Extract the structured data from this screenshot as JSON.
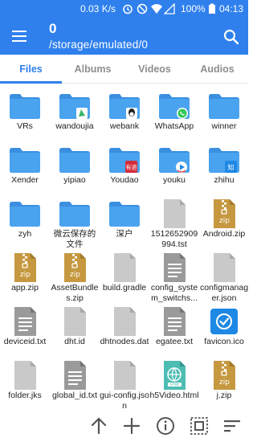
{
  "status_bar": {
    "speed": "0.03 K/s",
    "battery": "100%",
    "time": "04:13",
    "icons": [
      "alarm-icon",
      "no-sound-icon",
      "wifi-icon",
      "cellular-off-icon",
      "battery-icon"
    ]
  },
  "app_bar": {
    "item_count": "0",
    "path": "/storage/emulated/0",
    "icons": {
      "menu": "menu-icon",
      "search": "search-icon"
    }
  },
  "tabs": [
    {
      "label": "Files",
      "active": true
    },
    {
      "label": "Albums",
      "active": false
    },
    {
      "label": "Videos",
      "active": false
    },
    {
      "label": "Audios",
      "active": false
    }
  ],
  "files": [
    {
      "name": "VRs",
      "type": "folder"
    },
    {
      "name": "wandoujia",
      "type": "folder",
      "badge": "wandoujia"
    },
    {
      "name": "webank",
      "type": "folder",
      "badge": "qq"
    },
    {
      "name": "WhatsApp",
      "type": "folder",
      "badge": "whatsapp"
    },
    {
      "name": "winner",
      "type": "folder"
    },
    {
      "name": "Xender",
      "type": "folder"
    },
    {
      "name": "yipiao",
      "type": "folder"
    },
    {
      "name": "Youdao",
      "type": "folder",
      "badge": "youdao",
      "badge_text": "有道"
    },
    {
      "name": "youku",
      "type": "folder",
      "badge": "youku"
    },
    {
      "name": "zhihu",
      "type": "folder",
      "badge": "zhihu",
      "badge_text": "知"
    },
    {
      "name": "zyh",
      "type": "folder"
    },
    {
      "name": "微云保存的文件",
      "type": "folder"
    },
    {
      "name": "深户",
      "type": "folder"
    },
    {
      "name": "1512652909994.tst",
      "type": "doc-blank"
    },
    {
      "name": "Android.zip",
      "type": "zip",
      "ext_label": "zip"
    },
    {
      "name": "app.zip",
      "type": "zip",
      "ext_label": "zip"
    },
    {
      "name": "AssetBundles.zip",
      "type": "zip",
      "ext_label": "zip"
    },
    {
      "name": "build.gradle",
      "type": "doc-blank"
    },
    {
      "name": "config_system_switchs...",
      "type": "doc-lines"
    },
    {
      "name": "configmanager.json",
      "type": "doc-blank"
    },
    {
      "name": "deviceid.txt",
      "type": "doc-lines"
    },
    {
      "name": "dht.id",
      "type": "doc-blank"
    },
    {
      "name": "dhtnodes.dat",
      "type": "doc-blank"
    },
    {
      "name": "egatee.txt",
      "type": "doc-lines"
    },
    {
      "name": "favicon.ico",
      "type": "image-check"
    },
    {
      "name": "folder.jks",
      "type": "doc-blank"
    },
    {
      "name": "global_id.txt",
      "type": "doc-lines"
    },
    {
      "name": "gui-config.json",
      "type": "doc-blank"
    },
    {
      "name": "h5Video.html",
      "type": "html"
    },
    {
      "name": "j.zip",
      "type": "zip",
      "ext_label": "zip"
    }
  ],
  "bottom_bar": {
    "icons": [
      "up-arrow-icon",
      "add-icon",
      "info-icon",
      "select-all-icon",
      "sort-icon"
    ]
  },
  "colors": {
    "primary": "#2f80ed",
    "folder": "#4aa3ef",
    "folder_back": "#3b8fe0",
    "doc": "#c9c9c9",
    "zip": "#c6983f",
    "tab_inactive": "#8e8e8e"
  }
}
